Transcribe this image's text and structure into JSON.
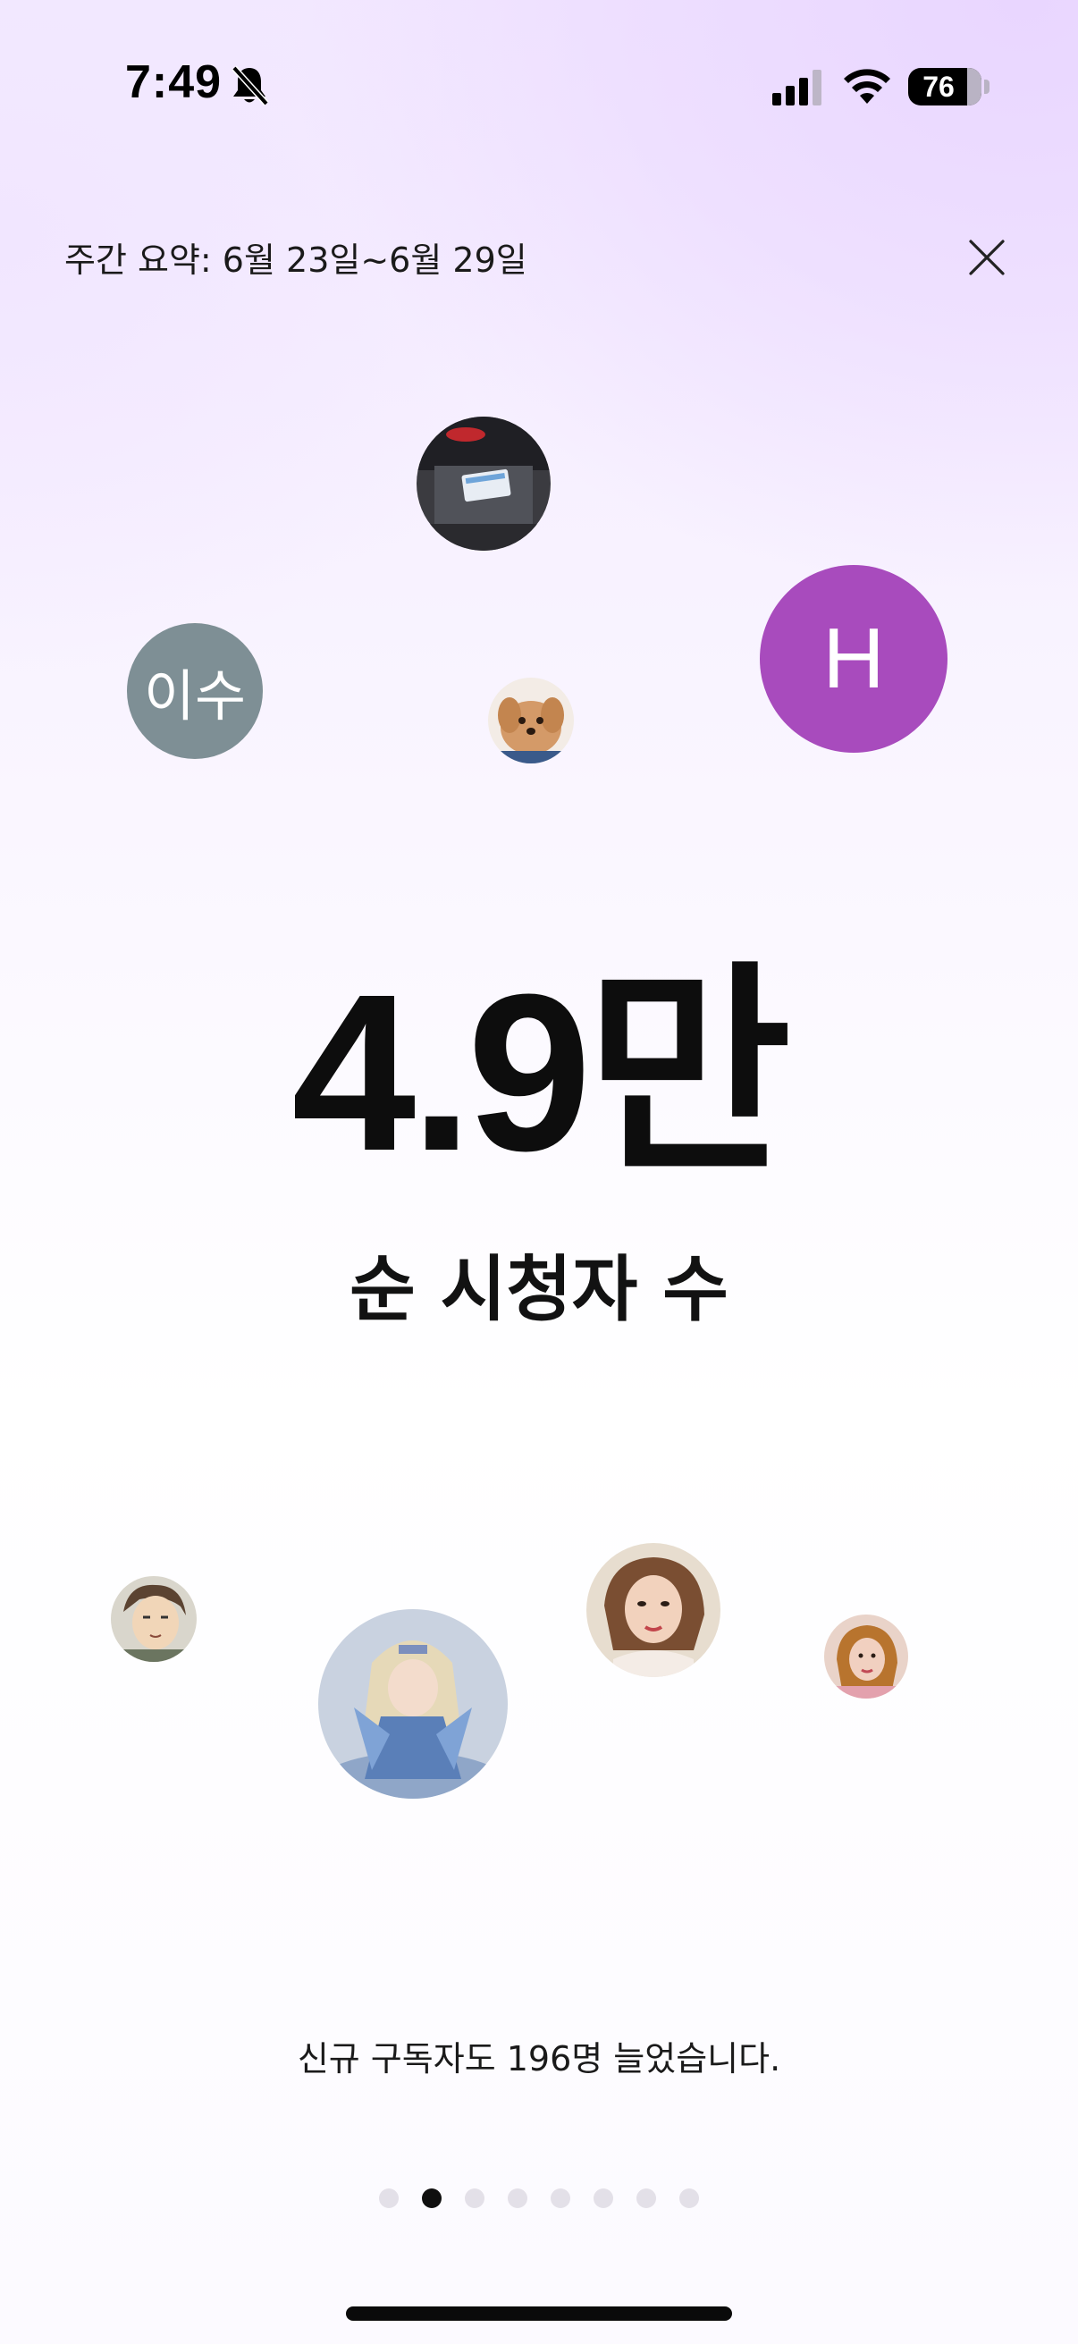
{
  "status_bar": {
    "time": "7:49",
    "icons": [
      "bell-slash-icon",
      "cellular-signal-icon",
      "wifi-icon",
      "battery-icon"
    ],
    "battery_level": "76"
  },
  "header": {
    "title": "주간 요약: 6월 23일~6월 29일",
    "close_icon": "close-icon"
  },
  "avatars": {
    "top": [
      {
        "kind": "photo",
        "subject": "car license plate"
      },
      {
        "kind": "letter",
        "text": "이수",
        "color": "#7e8f95"
      },
      {
        "kind": "photo",
        "subject": "puppy"
      },
      {
        "kind": "letter",
        "text": "H",
        "color": "#a84bbd"
      }
    ],
    "bottom": [
      {
        "kind": "photo",
        "subject": "anime boy"
      },
      {
        "kind": "photo",
        "subject": "fantasy character"
      },
      {
        "kind": "photo",
        "subject": "woman portrait"
      },
      {
        "kind": "photo",
        "subject": "woman portrait"
      }
    ]
  },
  "stat": {
    "value": "4.9만",
    "label": "순 시청자 수"
  },
  "subscriber_message": "신규 구독자도 196명 늘었습니다.",
  "pagination": {
    "total_pages": 8,
    "current_page": 2
  },
  "colors": {
    "accent_gradient": "#e9d6ff",
    "text": "#111111",
    "dot_active": "#0f0f0f",
    "dot_inactive": "#e3e0e8"
  }
}
